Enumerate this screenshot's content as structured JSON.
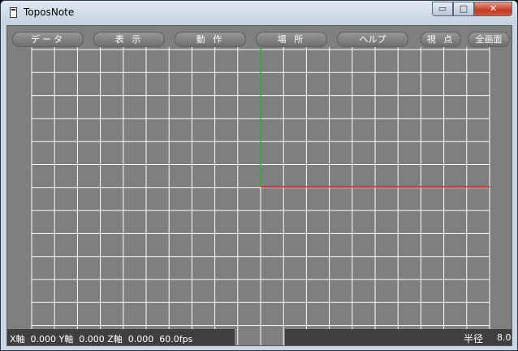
{
  "window": {
    "title": "ToposNote",
    "minimize_glyph": "▭",
    "maximize_glyph": "□",
    "close_glyph": "✕"
  },
  "menu": {
    "data": "データ",
    "view": "表 示",
    "action": "動 作",
    "place": "場 所",
    "help": "ヘルプ",
    "viewpoint": "視 点",
    "fullscreen": "全画面"
  },
  "viewport": {
    "grid_color": "#ffffff",
    "background_color": "#7f7f7f",
    "x_axis_color": "#d11b1b",
    "y_axis_color": "#21b62a"
  },
  "status": {
    "coords": "X軸  0.000 Y軸  0.000 Z軸  0.000  60.0fps",
    "radius_label": "半径",
    "radius_value": "8.0"
  }
}
